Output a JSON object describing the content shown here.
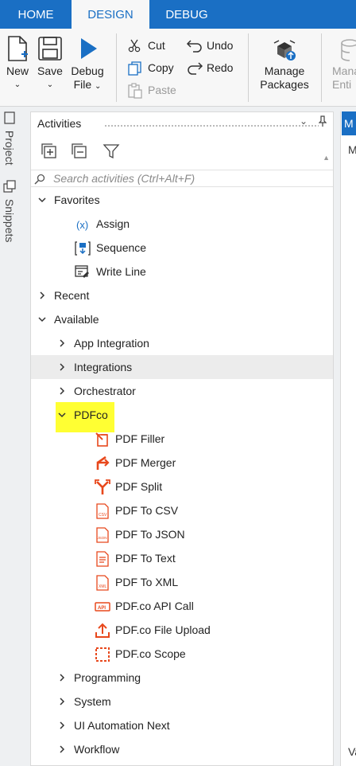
{
  "tabs": [
    "HOME",
    "DESIGN",
    "DEBUG"
  ],
  "ribbon": {
    "new": "New",
    "save": "Save",
    "debug_line1": "Debug",
    "debug_line2": "File",
    "cut": "Cut",
    "copy": "Copy",
    "paste": "Paste",
    "undo": "Undo",
    "redo": "Redo",
    "manage_line1": "Manage",
    "manage_line2": "Packages",
    "entities_line1": "Mana",
    "entities_line2": "Enti"
  },
  "side_tabs": [
    "Project",
    "Snippets"
  ],
  "panel": {
    "title": "Activities",
    "search_placeholder": "Search activities (Ctrl+Alt+F)"
  },
  "tree": {
    "favorites": {
      "label": "Favorites",
      "items": [
        "Assign",
        "Sequence",
        "Write Line"
      ]
    },
    "recent": "Recent",
    "available": "Available",
    "groups_before": [
      "App Integration",
      "Integrations",
      "Orchestrator"
    ],
    "pdfco": {
      "label": "PDFco",
      "items": [
        "PDF Filler",
        "PDF Merger",
        "PDF Split",
        "PDF To CSV",
        "PDF To JSON",
        "PDF To Text",
        "PDF To XML",
        "PDF.co API Call",
        "PDF.co File Upload",
        "PDF.co Scope"
      ]
    },
    "groups_after": [
      "Programming",
      "System",
      "UI Automation Next",
      "Workflow"
    ]
  },
  "right_panel": {
    "tab_label": "M",
    "label_top": "M",
    "label_bottom": "Va"
  },
  "colors": {
    "accent": "#1a6fc4",
    "highlight": "#ffff33",
    "pdfco_icon": "#e8481c"
  }
}
